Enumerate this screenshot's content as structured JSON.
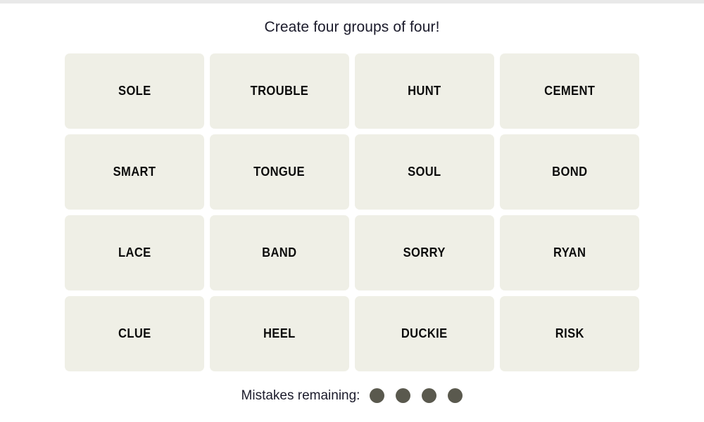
{
  "colors": {
    "page_background": "#ffffff",
    "top_strip": "#e9e9e9",
    "tile_background": "#efefe6",
    "tile_text": "#0b0b0b",
    "title_text": "#1b1b2b",
    "mistake_dot": "#5a594e"
  },
  "header": {
    "title": "Create four groups of four!"
  },
  "grid": {
    "columns": 4,
    "rows": 4,
    "tiles": [
      {
        "label": "SOLE"
      },
      {
        "label": "TROUBLE"
      },
      {
        "label": "HUNT"
      },
      {
        "label": "CEMENT"
      },
      {
        "label": "SMART"
      },
      {
        "label": "TONGUE"
      },
      {
        "label": "SOUL"
      },
      {
        "label": "BOND"
      },
      {
        "label": "LACE"
      },
      {
        "label": "BAND"
      },
      {
        "label": "SORRY"
      },
      {
        "label": "RYAN"
      },
      {
        "label": "CLUE"
      },
      {
        "label": "HEEL"
      },
      {
        "label": "DUCKIE"
      },
      {
        "label": "RISK"
      }
    ]
  },
  "footer": {
    "mistakes_label": "Mistakes remaining:",
    "mistakes_remaining": 4,
    "dots": [
      {
        "name": "mistake-dot-1"
      },
      {
        "name": "mistake-dot-2"
      },
      {
        "name": "mistake-dot-3"
      },
      {
        "name": "mistake-dot-4"
      }
    ]
  }
}
